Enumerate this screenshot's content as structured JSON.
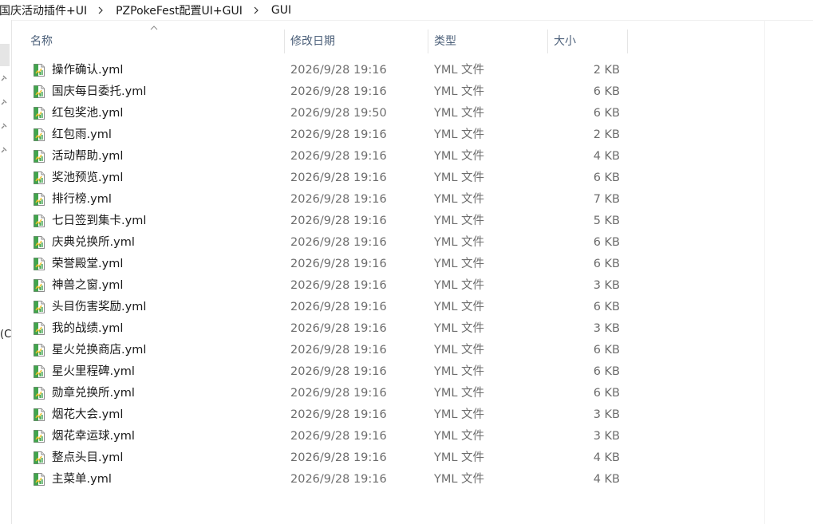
{
  "breadcrumb": {
    "items": [
      "国庆活动插件+UI",
      "PZPokeFest配置UI+GUI",
      "GUI"
    ]
  },
  "nav": {
    "partial_label": "(C"
  },
  "columns": {
    "name": "名称",
    "modified": "修改日期",
    "type": "类型",
    "size": "大小"
  },
  "sort": {
    "column": "name",
    "direction": "ascending"
  },
  "files": [
    {
      "name": "操作确认.yml",
      "modified": "2026/9/28 19:16",
      "type": "YML 文件",
      "size": "2 KB"
    },
    {
      "name": "国庆每日委托.yml",
      "modified": "2026/9/28 19:16",
      "type": "YML 文件",
      "size": "6 KB"
    },
    {
      "name": "红包奖池.yml",
      "modified": "2026/9/28 19:50",
      "type": "YML 文件",
      "size": "6 KB"
    },
    {
      "name": "红包雨.yml",
      "modified": "2026/9/28 19:16",
      "type": "YML 文件",
      "size": "2 KB"
    },
    {
      "name": "活动帮助.yml",
      "modified": "2026/9/28 19:16",
      "type": "YML 文件",
      "size": "4 KB"
    },
    {
      "name": "奖池预览.yml",
      "modified": "2026/9/28 19:16",
      "type": "YML 文件",
      "size": "6 KB"
    },
    {
      "name": "排行榜.yml",
      "modified": "2026/9/28 19:16",
      "type": "YML 文件",
      "size": "7 KB"
    },
    {
      "name": "七日签到集卡.yml",
      "modified": "2026/9/28 19:16",
      "type": "YML 文件",
      "size": "5 KB"
    },
    {
      "name": "庆典兑换所.yml",
      "modified": "2026/9/28 19:16",
      "type": "YML 文件",
      "size": "6 KB"
    },
    {
      "name": "荣誉殿堂.yml",
      "modified": "2026/9/28 19:16",
      "type": "YML 文件",
      "size": "6 KB"
    },
    {
      "name": "神兽之窗.yml",
      "modified": "2026/9/28 19:16",
      "type": "YML 文件",
      "size": "3 KB"
    },
    {
      "name": "头目伤害奖励.yml",
      "modified": "2026/9/28 19:16",
      "type": "YML 文件",
      "size": "6 KB"
    },
    {
      "name": "我的战绩.yml",
      "modified": "2026/9/28 19:16",
      "type": "YML 文件",
      "size": "3 KB"
    },
    {
      "name": "星火兑换商店.yml",
      "modified": "2026/9/28 19:16",
      "type": "YML 文件",
      "size": "6 KB"
    },
    {
      "name": "星火里程碑.yml",
      "modified": "2026/9/28 19:16",
      "type": "YML 文件",
      "size": "6 KB"
    },
    {
      "name": "勋章兑换所.yml",
      "modified": "2026/9/28 19:16",
      "type": "YML 文件",
      "size": "6 KB"
    },
    {
      "name": "烟花大会.yml",
      "modified": "2026/9/28 19:16",
      "type": "YML 文件",
      "size": "3 KB"
    },
    {
      "name": "烟花幸运球.yml",
      "modified": "2026/9/28 19:16",
      "type": "YML 文件",
      "size": "3 KB"
    },
    {
      "name": "整点头目.yml",
      "modified": "2026/9/28 19:16",
      "type": "YML 文件",
      "size": "4 KB"
    },
    {
      "name": "主菜单.yml",
      "modified": "2026/9/28 19:16",
      "type": "YML 文件",
      "size": "4 KB"
    }
  ],
  "icons": {
    "file": "yml-file-icon",
    "breadcrumb_separator": "chevron-right-icon",
    "sort": "chevron-up-icon",
    "pin": "pin-icon"
  },
  "colors": {
    "header_text": "#4c607a",
    "detail_text": "#6d6d6d",
    "name_text": "#1a1a1a",
    "file_icon_green": "#2e9a3a"
  }
}
